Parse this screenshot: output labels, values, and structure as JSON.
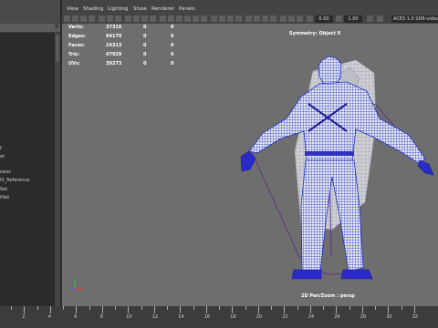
{
  "outliner": {
    "search_value": "p",
    "items": [
      "t",
      "et",
      "neos",
      "lit_Reference",
      "Set",
      "tSet"
    ]
  },
  "menu": [
    "View",
    "Shading",
    "Lighting",
    "Show",
    "Renderer",
    "Panels"
  ],
  "toolbar": {
    "exposure_value": "0.00",
    "gamma_value": "1.00",
    "color_space": "ACES 1.0 SDR-video (sRGB)"
  },
  "hud": {
    "stats": [
      {
        "label": "Verts:",
        "values": [
          "37316",
          "0",
          "0"
        ]
      },
      {
        "label": "Edges:",
        "values": [
          "84179",
          "0",
          "0"
        ]
      },
      {
        "label": "Faces:",
        "values": [
          "24313",
          "0",
          "0"
        ]
      },
      {
        "label": "Tris:",
        "values": [
          "47929",
          "0",
          "0"
        ]
      },
      {
        "label": "UVs:",
        "values": [
          "39273",
          "0",
          "0"
        ]
      }
    ],
    "symmetry": "Symmetry: Object X",
    "camera": "2D Pan/Zoom : persp"
  },
  "timeline": {
    "ticks": [
      "2",
      "4",
      "6",
      "8",
      "10",
      "12",
      "14",
      "16",
      "18",
      "20",
      "22",
      "24",
      "26",
      "28",
      "30",
      "32"
    ]
  }
}
